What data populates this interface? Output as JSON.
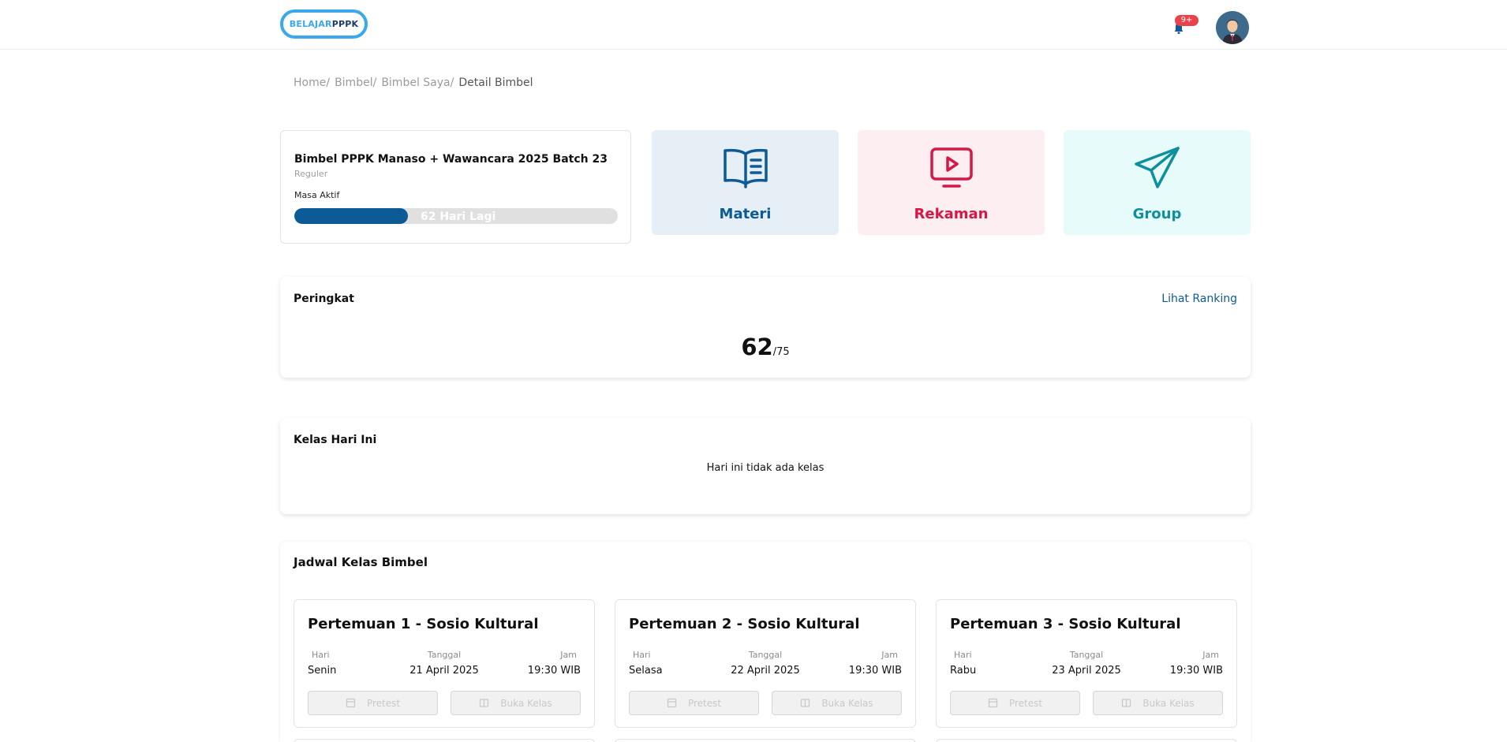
{
  "header": {
    "logo_part1": "BELAJAR",
    "logo_part2": "PPPK",
    "notification_count": "9+"
  },
  "breadcrumb": [
    {
      "label": "Home",
      "sep": "/"
    },
    {
      "label": "Bimbel",
      "sep": "/"
    },
    {
      "label": "Bimbel Saya",
      "sep": "/"
    },
    {
      "label": "Detail Bimbel"
    }
  ],
  "course": {
    "title": "Bimbel PPPK Manaso + Wawancara 2025 Batch 23",
    "type": "Reguler",
    "masa_label": "Masa Aktif",
    "remaining_text": "62 Hari Lagi",
    "progress_fraction": 0.35
  },
  "tiles": {
    "materi": "Materi",
    "rekaman": "Rekaman",
    "group": "Group"
  },
  "rank": {
    "title": "Peringkat",
    "link": "Lihat Ranking",
    "position": "62",
    "total": "/75"
  },
  "kelas_hari_ini": {
    "title": "Kelas Hari Ini",
    "empty": "Hari ini tidak ada kelas"
  },
  "jadwal": {
    "title": "Jadwal Kelas Bimbel",
    "col_hari": "Hari",
    "col_tanggal": "Tanggal",
    "col_jam": "Jam",
    "btn_pretest": "Pretest",
    "btn_buka": "Buka Kelas",
    "meetings": [
      {
        "title": "Pertemuan 1 - Sosio Kultural",
        "hari": "Senin",
        "tanggal": "21 April 2025",
        "jam": "19:30 WIB"
      },
      {
        "title": "Pertemuan 2 - Sosio Kultural",
        "hari": "Selasa",
        "tanggal": "22 April 2025",
        "jam": "19:30 WIB"
      },
      {
        "title": "Pertemuan 3 - Sosio Kultural",
        "hari": "Rabu",
        "tanggal": "23 April 2025",
        "jam": "19:30 WIB"
      }
    ]
  },
  "colors": {
    "primary": "#0c5a96",
    "rekaman": "#d51846",
    "group": "#0e8f9e",
    "badge": "#e8424a"
  }
}
